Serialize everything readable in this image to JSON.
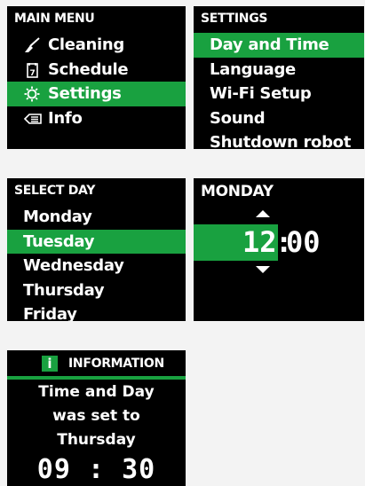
{
  "main_menu": {
    "title": "MAIN MENU",
    "items": [
      {
        "label": "Cleaning",
        "icon": "broom-icon"
      },
      {
        "label": "Schedule",
        "icon": "calendar-icon"
      },
      {
        "label": "Settings",
        "icon": "gear-icon",
        "selected": true
      },
      {
        "label": "Info",
        "icon": "info-card-icon"
      }
    ]
  },
  "settings_menu": {
    "title": "SETTINGS",
    "items": [
      {
        "label": "Day and Time",
        "selected": true
      },
      {
        "label": "Language"
      },
      {
        "label": "Wi-Fi Setup"
      },
      {
        "label": "Sound"
      },
      {
        "label": "Shutdown robot"
      }
    ]
  },
  "select_day": {
    "title": "SELECT DAY",
    "items": [
      {
        "label": "Monday"
      },
      {
        "label": "Tuesday",
        "selected": true
      },
      {
        "label": "Wednesday"
      },
      {
        "label": "Thursday"
      },
      {
        "label": "Friday"
      }
    ]
  },
  "time_setting": {
    "title": "MONDAY",
    "hour": "12",
    "separator": ":",
    "minute": "00"
  },
  "information": {
    "title": "INFORMATION",
    "badge": "i",
    "line1": "Time and Day",
    "line2": "was set to",
    "line3": "Thursday",
    "time": "09 : 30"
  },
  "colors": {
    "accent": "#19a140",
    "screen_bg": "#000000",
    "page_bg": "#f3f3f3"
  }
}
